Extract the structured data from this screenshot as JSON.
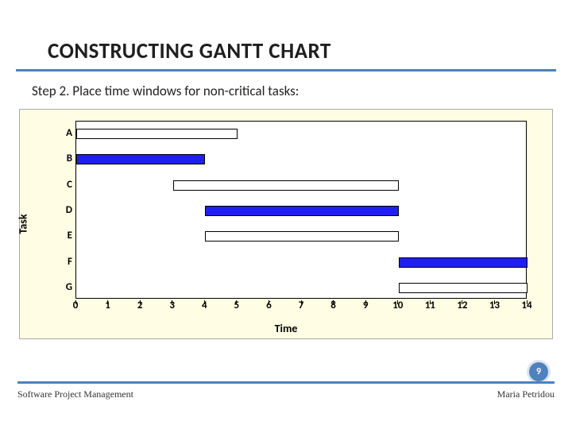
{
  "title": "CONSTRUCTING GANTT CHART",
  "subtitle": "Step 2. Place time windows for non-critical tasks:",
  "slide_number": "9",
  "footer_left": "Software Project Management",
  "footer_right": "Maria Petridou",
  "chart_data": {
    "type": "bar",
    "xlabel": "Time",
    "ylabel": "Task",
    "xlim": [
      0,
      14
    ],
    "ticks": [
      0,
      1,
      2,
      3,
      4,
      5,
      6,
      7,
      8,
      9,
      10,
      11,
      12,
      13,
      14
    ],
    "tasks": [
      "A",
      "B",
      "C",
      "D",
      "E",
      "F",
      "G"
    ],
    "bars": [
      {
        "task": "A",
        "type": "open",
        "start": 0,
        "end": 5
      },
      {
        "task": "B",
        "type": "critical",
        "start": 0,
        "end": 4
      },
      {
        "task": "C",
        "type": "open",
        "start": 3,
        "end": 10
      },
      {
        "task": "D",
        "type": "critical",
        "start": 4,
        "end": 10
      },
      {
        "task": "E",
        "type": "open",
        "start": 4,
        "end": 10
      },
      {
        "task": "F",
        "type": "critical",
        "start": 10,
        "end": 14
      },
      {
        "task": "G",
        "type": "open",
        "start": 10,
        "end": 14
      }
    ]
  }
}
